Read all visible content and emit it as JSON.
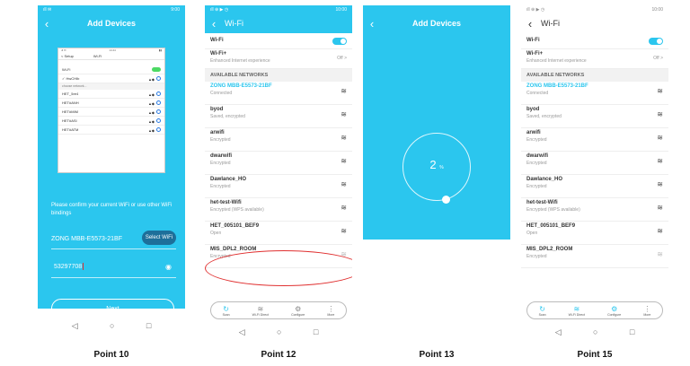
{
  "colors": {
    "accent": "#2bc6ee",
    "select_button": "#1d6f9a",
    "highlight": "#e03030"
  },
  "captions": [
    "Point 10",
    "Point 12",
    "Point 13",
    "Point 15"
  ],
  "p1": {
    "title": "Add Devices",
    "mini": {
      "time": "14:44",
      "back": "< Setup",
      "heading": "Wi-Fi",
      "wifi_label": "Wi-Fi",
      "current": "✓ HwCHIb",
      "section": "choose network...",
      "networks": [
        "HET_5re4",
        "HET#ANH",
        "HET#MIM",
        "HET#ASI",
        "HET#ATM"
      ]
    },
    "instruction": "Please confirm your current WiFi or use other WiFi bindings",
    "ssid": "ZONG MBB-E5573-21BF",
    "select_wifi": "Select WiFi",
    "password": "53297708",
    "next": "Next",
    "status_right": "9:00"
  },
  "p2": {
    "title": "Wi-Fi",
    "status_right": "10:00",
    "wifi_label": "Wi-Fi",
    "wifiplus_label": "Wi-Fi+",
    "wifiplus_sub": "Enhanced Internet experience",
    "wifiplus_value": "Off >",
    "section": "AVAILABLE NETWORKS",
    "networks": [
      {
        "name": "ZONG MBB-E5573-21BF",
        "status": "Connected"
      },
      {
        "name": "byod",
        "status": "Saved, encrypted"
      },
      {
        "name": "arwifi",
        "status": "Encrypted"
      },
      {
        "name": "dwarwifi",
        "status": "Encrypted"
      },
      {
        "name": "Dawlance_HO",
        "status": "Encrypted"
      },
      {
        "name": "het-test-Wifi",
        "status": "Encrypted (WPS available)"
      },
      {
        "name": "HET_005101_BEF9",
        "status": "Open"
      },
      {
        "name": "MIS_DPL2_ROOM",
        "status": "Encrypted"
      }
    ],
    "toolbar": [
      "Scan",
      "Wi-Fi Direct",
      "Configure",
      "More"
    ]
  },
  "p3": {
    "title": "Add Devices",
    "progress": "2",
    "unit": "%"
  },
  "p4": {
    "title": "Wi-Fi",
    "status_right": "10:00",
    "wifi_label": "Wi-Fi",
    "wifiplus_label": "Wi-Fi+",
    "wifiplus_sub": "Enhanced Internet experience",
    "wifiplus_value": "Off >",
    "section": "AVAILABLE NETWORKS",
    "networks": [
      {
        "name": "ZONG MBB-E5573-21BF",
        "status": "Connected"
      },
      {
        "name": "byod",
        "status": "Saved, encrypted"
      },
      {
        "name": "arwifi",
        "status": "Encrypted"
      },
      {
        "name": "dwarwifi",
        "status": "Encrypted"
      },
      {
        "name": "Dawlance_HO",
        "status": "Encrypted"
      },
      {
        "name": "het-test-Wifi",
        "status": "Encrypted (WPS available)"
      },
      {
        "name": "HET_005101_BEF9",
        "status": "Open"
      },
      {
        "name": "MIS_DPL2_ROOM",
        "status": "Encrypted"
      }
    ],
    "toolbar": [
      "Scan",
      "Wi-Fi Direct",
      "Configure",
      "More"
    ]
  }
}
